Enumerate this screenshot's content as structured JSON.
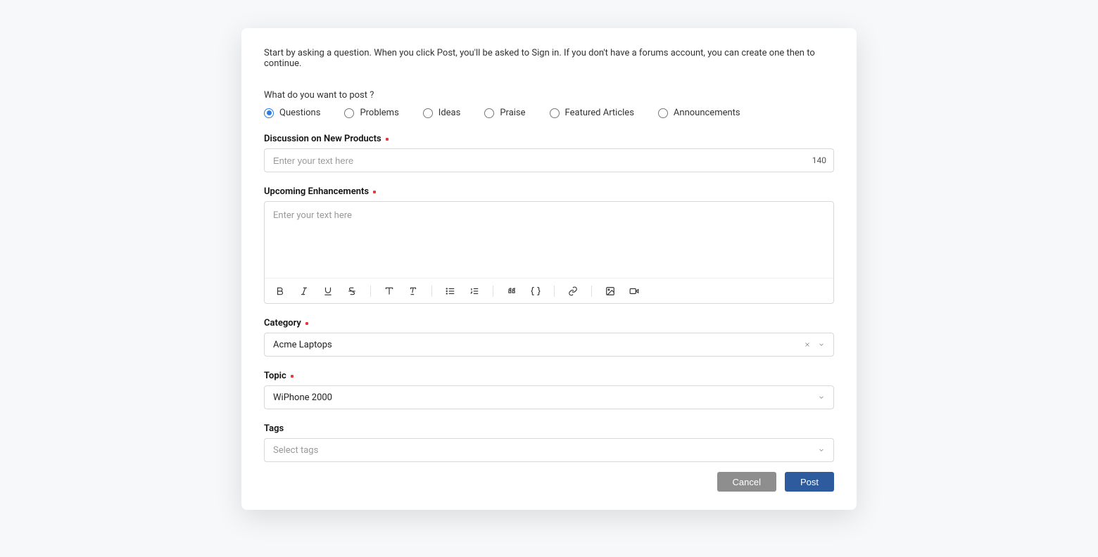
{
  "intro": "Start by asking a question. When you click Post, you'll be asked to Sign in. If you don't have a forums account, you can create one then to continue.",
  "prompt": "What do you want to post ?",
  "postTypes": [
    {
      "label": "Questions",
      "selected": true
    },
    {
      "label": "Problems",
      "selected": false
    },
    {
      "label": "Ideas",
      "selected": false
    },
    {
      "label": "Praise",
      "selected": false
    },
    {
      "label": "Featured Articles",
      "selected": false
    },
    {
      "label": "Announcements",
      "selected": false
    }
  ],
  "fields": {
    "title": {
      "label": "Discussion on New Products",
      "placeholder": "Enter your text here",
      "value": "",
      "charCount": "140"
    },
    "body": {
      "label": "Upcoming Enhancements",
      "placeholder": "Enter your text here",
      "value": ""
    },
    "category": {
      "label": "Category",
      "value": "Acme Laptops"
    },
    "topic": {
      "label": "Topic",
      "value": "WiPhone 2000"
    },
    "tags": {
      "label": "Tags",
      "placeholder": "Select tags",
      "value": ""
    }
  },
  "buttons": {
    "cancel": "Cancel",
    "post": "Post"
  },
  "toolbar": [
    "bold",
    "italic",
    "underline",
    "strike",
    "sep",
    "font-size",
    "clear-format",
    "sep",
    "ul",
    "ol",
    "sep",
    "quote",
    "code",
    "sep",
    "link",
    "sep",
    "image",
    "video"
  ]
}
